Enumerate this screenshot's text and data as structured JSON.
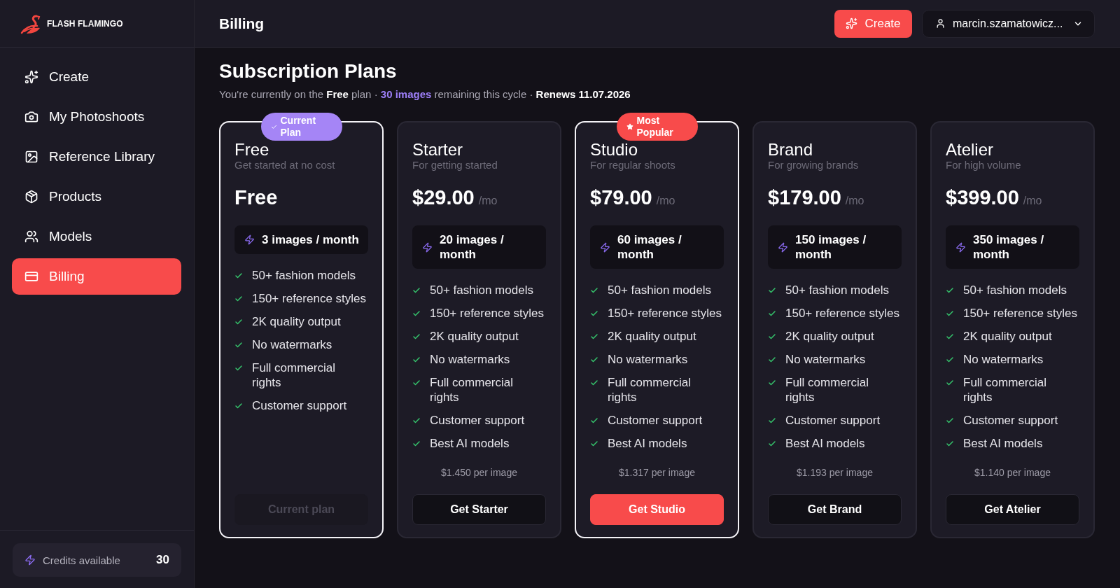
{
  "sidebar": {
    "logo": "FLASH FLAMINGO",
    "items": [
      {
        "label": "Create",
        "selected": false
      },
      {
        "label": "My Photoshoots",
        "selected": false
      },
      {
        "label": "Reference Library",
        "selected": false
      },
      {
        "label": "Products",
        "selected": false
      },
      {
        "label": "Models",
        "selected": false
      },
      {
        "label": "Billing",
        "selected": true
      }
    ],
    "credits": {
      "label": "Credits available",
      "value": "30"
    }
  },
  "header": {
    "title": "Billing",
    "create_button": "Create",
    "account": "marcin.szamatowicz..."
  },
  "page": {
    "title": "Subscription Plans",
    "status": [
      {
        "text": "You're currently on the ",
        "kind": "plain"
      },
      {
        "text": "Free",
        "kind": "bold"
      },
      {
        "text": " plan · ",
        "kind": "plain"
      },
      {
        "text": "30 images",
        "kind": "accent"
      },
      {
        "text": " remaining this cycle · ",
        "kind": "plain"
      },
      {
        "text": "Renews 11.07.2026",
        "kind": "bold"
      }
    ]
  },
  "plans": [
    {
      "name": "Free",
      "description": "Get started at no cost",
      "price": "Free",
      "highlighted": true,
      "badge": {
        "kind": "current",
        "label": "Current Plan"
      },
      "allowance": "3 images / month",
      "features": [
        "50+ fashion models",
        "150+ reference styles",
        "2K quality output",
        "No watermarks",
        "Full commercial rights",
        "Customer support"
      ],
      "button": {
        "label": "Current plan",
        "kind": "disabled"
      }
    },
    {
      "name": "Starter",
      "description": "For getting started",
      "price": "$29.00",
      "period": "/mo",
      "highlighted": false,
      "allowance": "20 images / month",
      "features": [
        "50+ fashion models",
        "150+ reference styles",
        "2K quality output",
        "No watermarks",
        "Full commercial rights",
        "Customer support",
        "Best AI models"
      ],
      "per_image": "$1.450 per image",
      "button": {
        "label": "Get Starter",
        "kind": "secondary"
      }
    },
    {
      "name": "Studio",
      "description": "For regular shoots",
      "price": "$79.00",
      "period": "/mo",
      "highlighted": true,
      "badge": {
        "kind": "popular",
        "label": "Most Popular"
      },
      "allowance": "60 images / month",
      "features": [
        "50+ fashion models",
        "150+ reference styles",
        "2K quality output",
        "No watermarks",
        "Full commercial rights",
        "Customer support",
        "Best AI models"
      ],
      "per_image": "$1.317 per image",
      "button": {
        "label": "Get Studio",
        "kind": "primary"
      }
    },
    {
      "name": "Brand",
      "description": "For growing brands",
      "price": "$179.00",
      "period": "/mo",
      "highlighted": false,
      "allowance": "150 images / month",
      "features": [
        "50+ fashion models",
        "150+ reference styles",
        "2K quality output",
        "No watermarks",
        "Full commercial rights",
        "Customer support",
        "Best AI models"
      ],
      "per_image": "$1.193 per image",
      "button": {
        "label": "Get Brand",
        "kind": "secondary"
      }
    },
    {
      "name": "Atelier",
      "description": "For high volume",
      "price": "$399.00",
      "period": "/mo",
      "highlighted": false,
      "allowance": "350 images / month",
      "features": [
        "50+ fashion models",
        "150+ reference styles",
        "2K quality output",
        "No watermarks",
        "Full commercial rights",
        "Customer support",
        "Best AI models"
      ],
      "per_image": "$1.140 per image",
      "button": {
        "label": "Get Atelier",
        "kind": "secondary"
      }
    }
  ]
}
